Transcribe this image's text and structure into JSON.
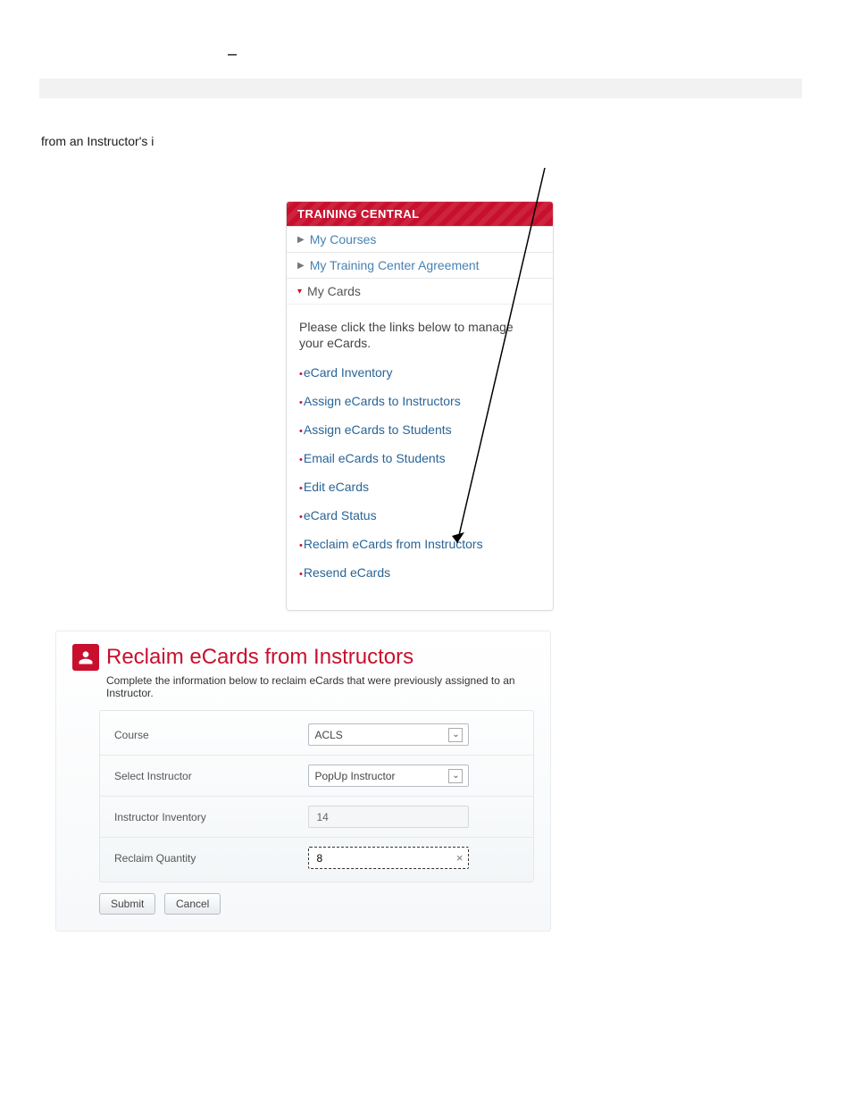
{
  "top_dash": "–",
  "intro_text": "from an Instructor's i",
  "panel": {
    "header": "TRAINING CENTRAL",
    "items": [
      {
        "label": "My Courses",
        "caret": "▶",
        "active": false
      },
      {
        "label": "My Training Center Agreement",
        "caret": "▶",
        "active": false
      },
      {
        "label": "My Cards",
        "caret": "▾",
        "active": true
      }
    ],
    "body_text": "Please click the links below to manage your eCards.",
    "links": [
      "eCard Inventory",
      "Assign eCards to Instructors",
      "Assign eCards to Students",
      "Email eCards to Students",
      "Edit eCards",
      "eCard Status",
      "Reclaim eCards from Instructors",
      "Resend eCards"
    ]
  },
  "reclaim": {
    "title": "Reclaim eCards from Instructors",
    "subtitle": "Complete the information below to reclaim eCards that were previously assigned to an Instructor.",
    "course_label": "Course",
    "course_value": "ACLS",
    "instructor_label": "Select Instructor",
    "instructor_value": "PopUp Instructor",
    "inventory_label": "Instructor Inventory",
    "inventory_value": "14",
    "quantity_label": "Reclaim Quantity",
    "quantity_value": "8",
    "submit_label": "Submit",
    "cancel_label": "Cancel",
    "clear_icon": "×"
  }
}
